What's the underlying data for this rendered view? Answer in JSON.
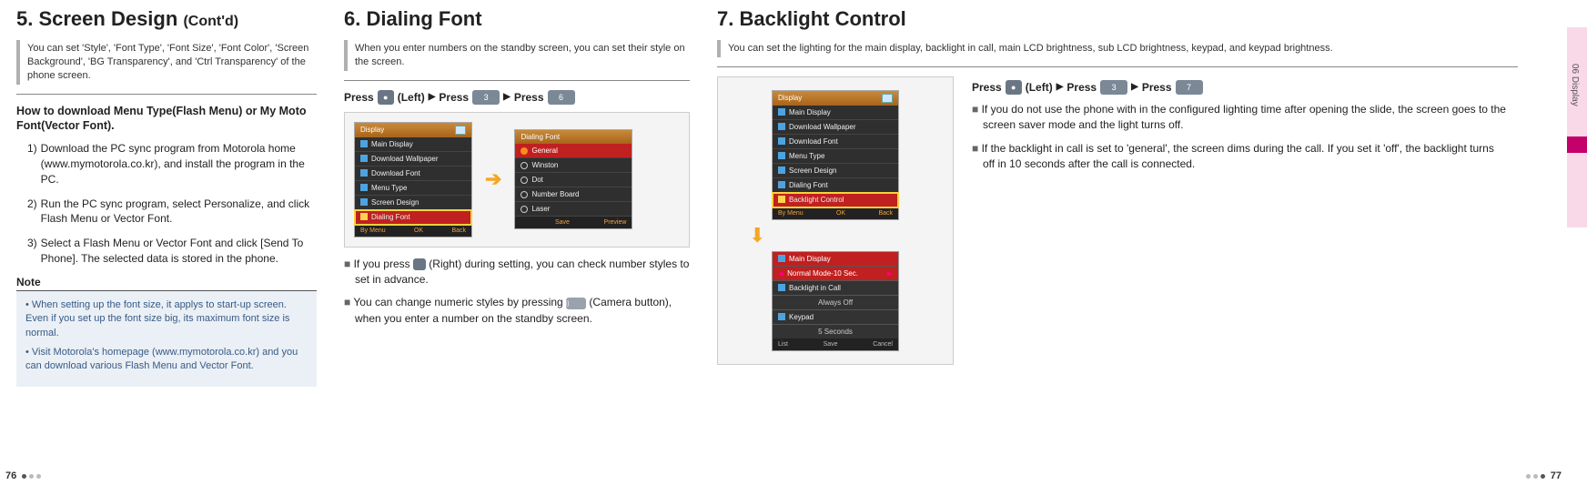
{
  "sidetab": {
    "label": "06 Display"
  },
  "pagenum": {
    "left": "76",
    "right": "77"
  },
  "sec5": {
    "title": "5. Screen Design",
    "contd": "(Cont'd)",
    "intro": "You can set 'Style', 'Font Type', 'Font Size', 'Font Color', 'Screen Background', 'BG Transparency', and 'Ctrl Transparency' of the phone screen.",
    "subhead": "How to download Menu Type(Flash Menu) or My Moto Font(Vector Font).",
    "steps": [
      "Download the PC sync program from Motorola home (www.mymotorola.co.kr), and install the program in the PC.",
      "Run the PC sync program, select Personalize, and click Flash Menu or Vector Font.",
      "Select a Flash Menu or Vector Font and click [Send To Phone]. The selected data is stored in the phone."
    ],
    "note_title": "Note",
    "notes": [
      "When setting up the font size, it applys to start-up screen. Even if you set up the font size big, its maximum font size is normal.",
      "Visit Motorola's homepage (www.mymotorola.co.kr) and you can download various Flash Menu and Vector Font."
    ]
  },
  "sec6": {
    "title": "6. Dialing Font",
    "intro": "When you enter numbers on the standby screen, you can set their style on the screen.",
    "press_parts": {
      "press": "Press",
      "left": "(Left)",
      "k1": "●",
      "k2": "3",
      "k3": "6"
    },
    "phone1": {
      "title": "Display",
      "items": [
        "Main Display",
        "Download Wallpaper",
        "Download Font",
        "Menu Type",
        "Screen Design",
        "Dialing Font"
      ],
      "selected_index": 5,
      "soft": [
        "By Menu",
        "OK",
        "Back"
      ]
    },
    "phone2": {
      "title": "Dialing Font",
      "items": [
        "General",
        "Winston",
        "Dot",
        "Number Board",
        "Laser"
      ],
      "selected_index": 0,
      "soft": [
        "",
        "Save",
        "Preview"
      ]
    },
    "bullets": [
      "If you press  (Right) during setting, you can check number styles to set in advance.",
      "You can change numeric styles by pressing  (Camera button), when you enter a number on the standby screen."
    ],
    "bullet_prefix": "■ ",
    "inlinekey_right": "●",
    "inlinekey_cam": "⌷"
  },
  "sec7": {
    "title": "7. Backlight Control",
    "intro": "You can set the lighting for the main display, backlight in call, main LCD brightness, sub LCD brightness, keypad, and keypad brightness.",
    "press_parts": {
      "press": "Press",
      "left": "(Left)",
      "k1": "●",
      "k2": "3",
      "k3": "7"
    },
    "phone": {
      "title": "Display",
      "items": [
        "Main Display",
        "Download Wallpaper",
        "Download Font",
        "Menu Type",
        "Screen Design",
        "Dialing Font",
        "Backlight Control"
      ],
      "selected_index": 6,
      "soft": [
        "By Menu",
        "OK",
        "Back"
      ]
    },
    "sublist": {
      "header": "Main Display",
      "rows": [
        {
          "label": "Normal Mode-10 Sec.",
          "sel": true,
          "chevrons": true
        },
        {
          "label": "Backlight in Call",
          "value": ""
        },
        {
          "label": "Always Off",
          "value": "",
          "indent": true
        },
        {
          "label": "Keypad",
          "value": ""
        },
        {
          "label": "5 Seconds",
          "value": "",
          "indent": true
        }
      ],
      "soft": [
        "List",
        "Save",
        "Cancel"
      ]
    },
    "bullets": [
      "If you do not use the phone with in the configured lighting time after opening the slide, the screen goes to the screen saver mode and the light turns off.",
      "If the backlight in call is set to 'general', the screen dims during the call. If you set it 'off', the backlight turns off in 10 seconds after the call is connected."
    ],
    "bullet_prefix": "■ "
  }
}
